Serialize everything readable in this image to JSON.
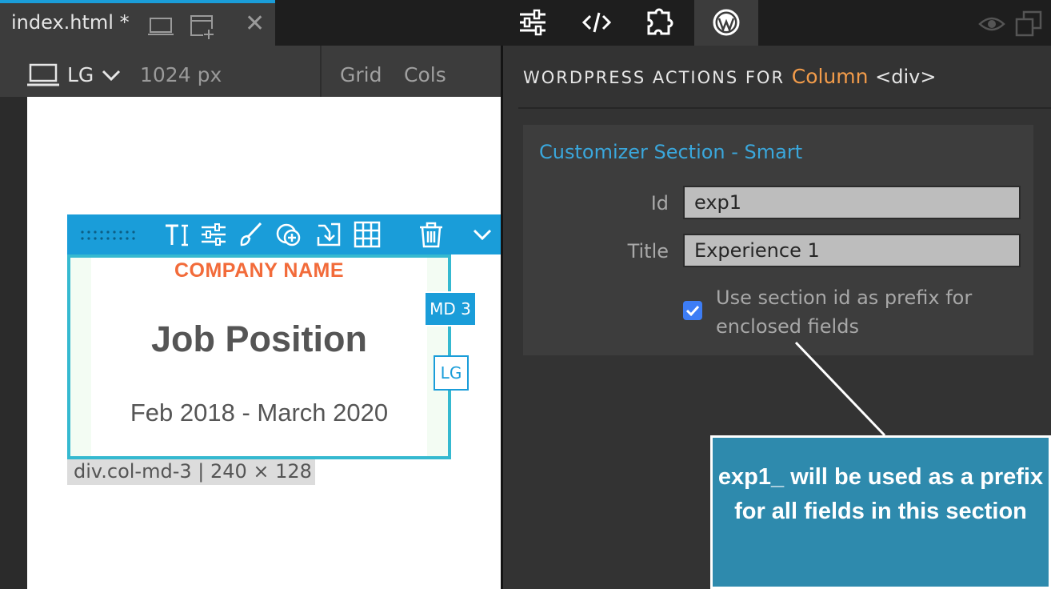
{
  "tab": {
    "title": "index.html *"
  },
  "canvas_bar": {
    "device": "LG",
    "width": "1024 px",
    "grid": "Grid",
    "cols": "Cols"
  },
  "element": {
    "company": "COMPANY NAME",
    "job": "Job Position",
    "dates": "Feb 2018 - March 2020",
    "md_badge": "MD 3",
    "lg_badge": "LG",
    "dim_label": "div.col-md-3 | 240 × 128"
  },
  "panel": {
    "header_prefix": "WORDPRESS ACTIONS FOR",
    "header_element": "Column",
    "header_tag": "<div>",
    "section_title": "Customizer Section - Smart",
    "id_label": "Id",
    "id_value": "exp1",
    "title_label": "Title",
    "title_value": "Experience 1",
    "checkbox_label": "Use section id as prefix for enclosed fields",
    "checkbox_checked": true
  },
  "callout": {
    "text": "exp1_ will be used as a prefix for all fields in this section"
  },
  "colors": {
    "accent": "#1a9dd9",
    "company": "#f26b3a",
    "column_word": "#f39c4a",
    "section_title": "#3aa7dc",
    "callout_bg": "#2e8aad",
    "checkbox": "#3d7df5"
  },
  "icons": {
    "tab": [
      "laptop-icon",
      "add-window-icon",
      "close-icon"
    ],
    "center_tools": [
      "sliders-icon",
      "code-icon",
      "puzzle-icon",
      "wordpress-icon"
    ],
    "right_tools": [
      "eye-icon",
      "windows-icon"
    ],
    "element_tools": [
      "drag-handle-icon",
      "text-icon",
      "sliders-icon",
      "brush-icon",
      "add-circle-icon",
      "import-icon",
      "grid-icon",
      "trash-icon",
      "chevron-down-icon"
    ]
  }
}
